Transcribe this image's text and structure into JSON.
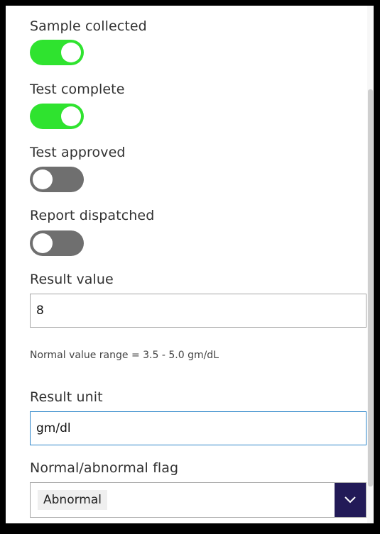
{
  "form": {
    "toggles": [
      {
        "label": "Sample collected",
        "on": true
      },
      {
        "label": "Test complete",
        "on": true
      },
      {
        "label": "Test approved",
        "on": false
      },
      {
        "label": "Report dispatched",
        "on": false
      }
    ],
    "result_value": {
      "label": "Result value",
      "value": "8"
    },
    "hint": "Normal value range = 3.5 - 5.0 gm/dL",
    "result_unit": {
      "label": "Result unit",
      "value": "gm/dl"
    },
    "flag": {
      "label": "Normal/abnormal flag",
      "selected": "Abnormal"
    }
  },
  "colors": {
    "toggle_on": "#2fe32f",
    "toggle_off": "#6f6f6f",
    "dropdown_button": "#221a57",
    "focus_border": "#2e86c9"
  },
  "icons": {
    "dropdown": "chevron-down-icon"
  }
}
